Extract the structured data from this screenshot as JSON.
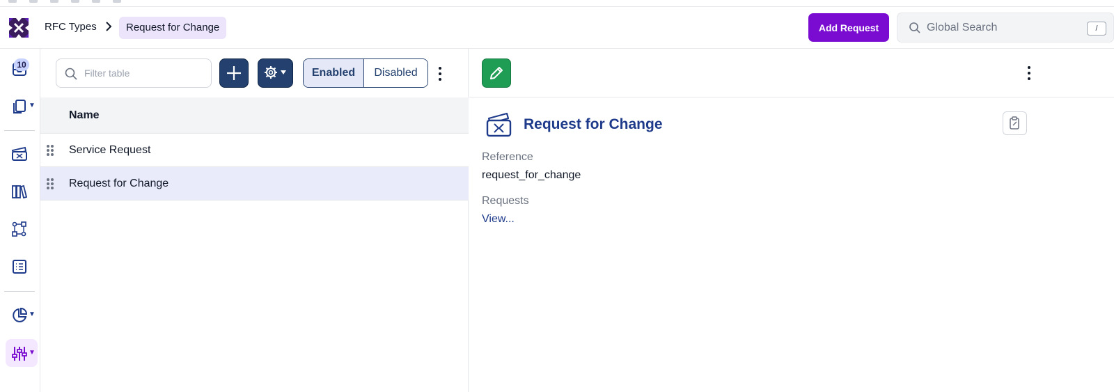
{
  "header": {
    "breadcrumb": [
      "RFC Types",
      "Request for Change"
    ],
    "add_request_label": "Add Request",
    "search_placeholder": "Global Search",
    "search_shortcut": "/"
  },
  "leftnav": {
    "inbox_badge": "10",
    "items": [
      "inbox-icon",
      "documents-icon",
      "ticket-icon",
      "library-icon",
      "workflow-icon",
      "list-icon",
      "reports-icon",
      "settings-sliders-icon"
    ]
  },
  "list": {
    "filter_placeholder": "Filter table",
    "toggle": {
      "enabled": "Enabled",
      "disabled": "Disabled",
      "active": "Enabled"
    },
    "columns": [
      "Name"
    ],
    "rows": [
      {
        "name": "Service Request",
        "selected": false
      },
      {
        "name": "Request for Change",
        "selected": true
      }
    ]
  },
  "detail": {
    "title": "Request for Change",
    "fields": [
      {
        "label": "Reference",
        "value": "request_for_change"
      },
      {
        "label": "Requests",
        "link": "View..."
      }
    ]
  },
  "colors": {
    "brand": "#7a0bd1",
    "navy": "#23406e",
    "edit_green": "#1f9d55",
    "title_blue": "#1e3a8a"
  }
}
